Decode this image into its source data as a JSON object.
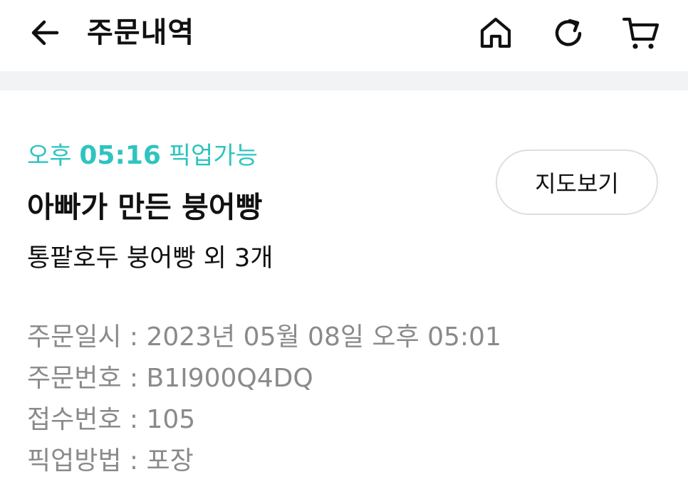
{
  "header": {
    "title": "주문내역",
    "back_icon": "arrow-left-icon",
    "home_icon": "home-icon",
    "refresh_icon": "refresh-icon",
    "cart_icon": "cart-icon"
  },
  "order": {
    "pickup_prefix": "오후 ",
    "pickup_time": "05:16",
    "pickup_suffix": " 픽업가능",
    "store_name": "아빠가 만든 붕어빵",
    "items_summary": "통팥호두 붕어빵 외 3개",
    "map_button_label": "지도보기",
    "details": [
      {
        "label": "주문일시",
        "value": "2023년 05월 08일 오후 05:01"
      },
      {
        "label": "주문번호",
        "value": "B1I900Q4DQ"
      },
      {
        "label": "접수번호",
        "value": "105"
      },
      {
        "label": "픽업방법",
        "value": "포장"
      }
    ],
    "separator": " : "
  },
  "colors": {
    "accent": "#2ec4c0",
    "muted_text": "#8a8a8a",
    "divider_band": "#f2f3f5"
  }
}
